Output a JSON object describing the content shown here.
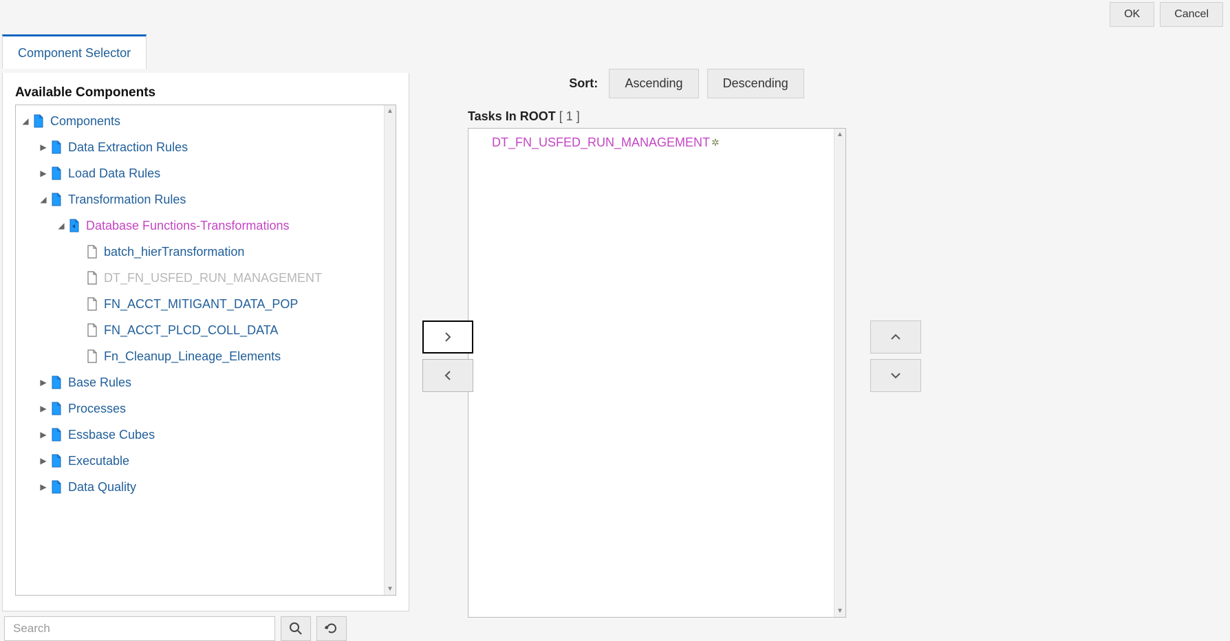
{
  "dialog": {
    "ok": "OK",
    "cancel": "Cancel"
  },
  "tab": {
    "label": "Component Selector"
  },
  "left": {
    "header": "Available Components",
    "search_placeholder": "Search"
  },
  "tree": {
    "root": "Components",
    "n_data_extraction": "Data Extraction Rules",
    "n_load_data": "Load Data Rules",
    "n_transformation": "Transformation Rules",
    "n_db_functions": "Database Functions-Transformations",
    "leaf_batch": "batch_hierTransformation",
    "leaf_dtfn": "DT_FN_USFED_RUN_MANAGEMENT",
    "leaf_fn_acct_mit": "FN_ACCT_MITIGANT_DATA_POP",
    "leaf_fn_acct_plcd": "FN_ACCT_PLCD_COLL_DATA",
    "leaf_fn_cleanup": "Fn_Cleanup_Lineage_Elements",
    "n_base_rules": "Base Rules",
    "n_processes": "Processes",
    "n_essbase": "Essbase Cubes",
    "n_executable": "Executable",
    "n_data_quality": "Data Quality"
  },
  "sort": {
    "label": "Sort:",
    "asc": "Ascending",
    "desc": "Descending"
  },
  "tasks": {
    "header_bold": "Tasks In ROOT",
    "header_count": "[ 1 ]",
    "items": [
      "DT_FN_USFED_RUN_MANAGEMENT"
    ]
  }
}
